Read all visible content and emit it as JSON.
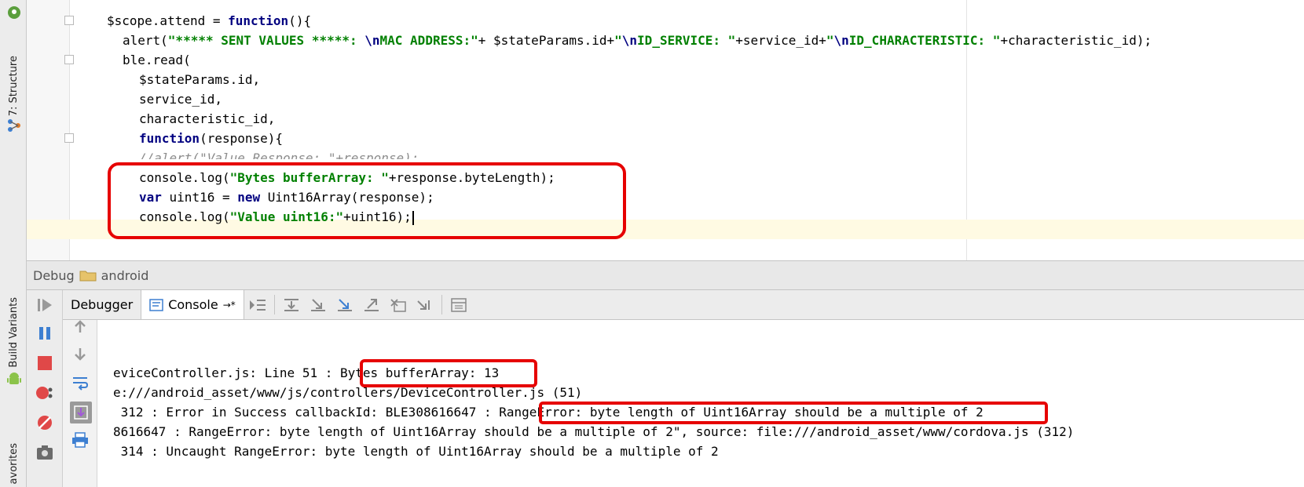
{
  "tool_windows": {
    "structure_label": "7: Structure",
    "build_variants_label": "Build Variants",
    "favorites_label": "avorites"
  },
  "editor": {
    "lines": [
      {
        "segments": [
          {
            "t": "$scope.attend = ",
            "c": "plain"
          },
          {
            "t": "function",
            "c": "kw"
          },
          {
            "t": "(){",
            "c": "plain"
          }
        ]
      },
      {
        "segments": [
          {
            "t": "alert(",
            "c": "plain"
          },
          {
            "t": "\"***** SENT VALUES *****: ",
            "c": "str"
          },
          {
            "t": "\\n",
            "c": "esc"
          },
          {
            "t": "MAC ADDRESS:\"",
            "c": "str"
          },
          {
            "t": "+ $stateParams.id+",
            "c": "plain"
          },
          {
            "t": "\"",
            "c": "str"
          },
          {
            "t": "\\n",
            "c": "esc"
          },
          {
            "t": "ID_SERVICE: \"",
            "c": "str"
          },
          {
            "t": "+service_id+",
            "c": "plain"
          },
          {
            "t": "\"",
            "c": "str"
          },
          {
            "t": "\\n",
            "c": "esc"
          },
          {
            "t": "ID_CHARACTERISTIC: \"",
            "c": "str"
          },
          {
            "t": "+characteristic_id);",
            "c": "plain"
          }
        ]
      },
      {
        "segments": [
          {
            "t": "ble.read(",
            "c": "plain"
          }
        ]
      },
      {
        "segments": [
          {
            "t": "$stateParams.id,",
            "c": "plain"
          }
        ]
      },
      {
        "segments": [
          {
            "t": "service_id,",
            "c": "plain"
          }
        ]
      },
      {
        "segments": [
          {
            "t": "characteristic_id,",
            "c": "plain"
          }
        ]
      },
      {
        "segments": [
          {
            "t": "function",
            "c": "kw"
          },
          {
            "t": "(response){",
            "c": "plain"
          }
        ]
      },
      {
        "segments": [
          {
            "t": "//alert(\"Value Response: \"+response);",
            "c": "cmt"
          }
        ]
      },
      {
        "segments": [
          {
            "t": "console.log(",
            "c": "plain"
          },
          {
            "t": "\"Bytes bufferArray: \"",
            "c": "str"
          },
          {
            "t": "+response.byteLength);",
            "c": "plain"
          }
        ]
      },
      {
        "segments": [
          {
            "t": "var",
            "c": "kw"
          },
          {
            "t": " uint16 = ",
            "c": "plain"
          },
          {
            "t": "new",
            "c": "kw"
          },
          {
            "t": " Uint16Array(response);",
            "c": "plain"
          }
        ]
      },
      {
        "segments": [
          {
            "t": "console.log(",
            "c": "plain"
          },
          {
            "t": "\"Value uint16:\"",
            "c": "str"
          },
          {
            "t": "+uint16);",
            "c": "plain"
          }
        ]
      }
    ]
  },
  "debug_panel": {
    "title": "Debug",
    "config_name": "android",
    "tabs": [
      {
        "label": "Debugger"
      },
      {
        "label": "Console",
        "suffix": "→*"
      }
    ]
  },
  "console": {
    "lines": [
      "eviceController.js: Line 51 : Bytes bufferArray: 13",
      "e:///android_asset/www/js/controllers/DeviceController.js (51)",
      " 312 : Error in Success callbackId: BLE308616647 : RangeError: byte length of Uint16Array should be a multiple of 2",
      "8616647 : RangeError: byte length of Uint16Array should be a multiple of 2\", source: file:///android_asset/www/cordova.js (312)",
      " 314 : Uncaught RangeError: byte length of Uint16Array should be a multiple of 2"
    ]
  },
  "colors": {
    "highlight": "#e60000",
    "keyword": "#000080",
    "string": "#008000"
  }
}
